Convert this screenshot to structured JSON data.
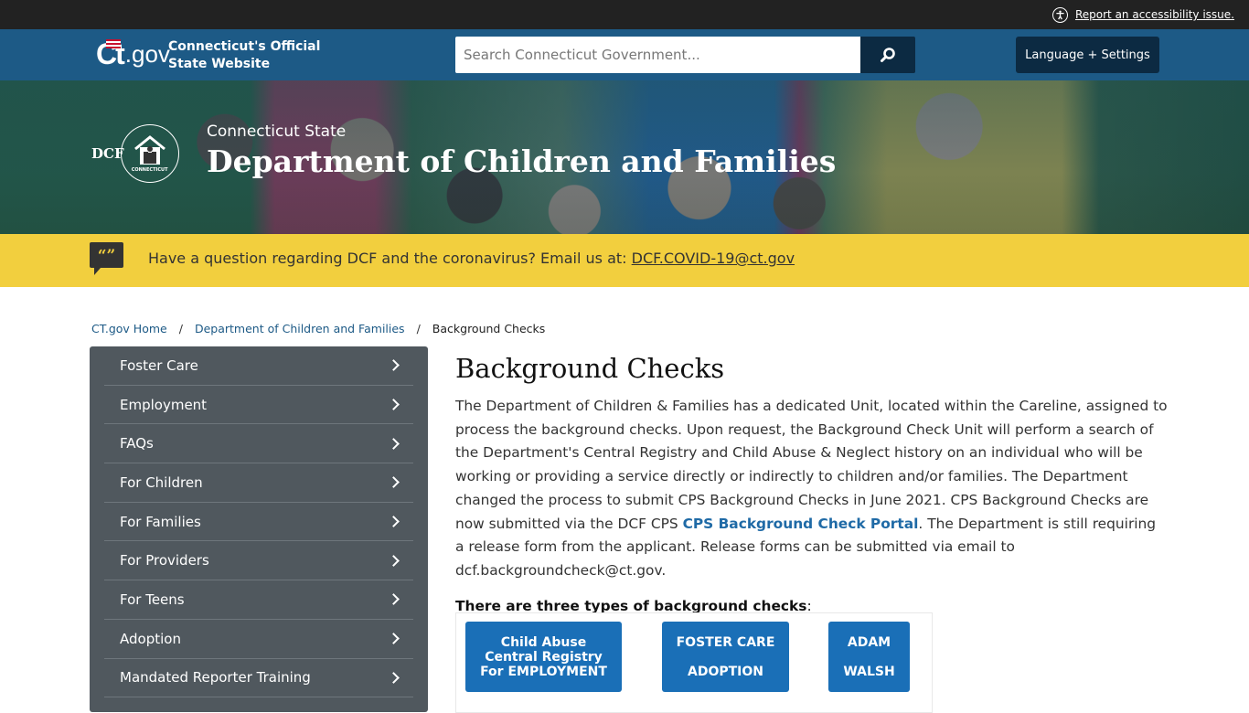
{
  "utility": {
    "accessibility_link": "Report an accessibility issue."
  },
  "header": {
    "logo_ct": "Ct",
    "logo_gov": ".gov",
    "site_name_line1": "Connecticut's Official",
    "site_name_line2": "State Website",
    "search_placeholder": "Search Connecticut Government...",
    "search_button_icon": "search-icon",
    "language_button": "Language + Settings"
  },
  "hero": {
    "logo_text": "DCF",
    "logo_small": "CONNECTICUT",
    "subtitle": "Connecticut State",
    "title": "Department of Children and Families"
  },
  "alert": {
    "icon": "quote-icon",
    "icon_glyph": "“”",
    "text": "Have a question regarding DCF and the coronavirus? Email us at: ",
    "email_link": "DCF.COVID-19@ct.gov"
  },
  "breadcrumb": {
    "items": [
      {
        "label": "CT.gov Home"
      },
      {
        "label": "Department of Children and Families"
      },
      {
        "label": "Background Checks"
      }
    ],
    "separator": "/"
  },
  "sidebar": {
    "items": [
      {
        "label": "Foster Care"
      },
      {
        "label": "Employment"
      },
      {
        "label": "FAQs"
      },
      {
        "label": "For Children"
      },
      {
        "label": "For Families"
      },
      {
        "label": "For Providers"
      },
      {
        "label": "For Teens"
      },
      {
        "label": "Adoption"
      },
      {
        "label": "Mandated Reporter Training"
      }
    ]
  },
  "main": {
    "title": "Background Checks",
    "paragraph_part1": "The Department of Children & Families has a dedicated Unit, located within the Careline, assigned to process the background checks. Upon request,  the Background Check Unit will perform a search of the Department's Central Registry and Child Abuse & Neglect history on an individual who will be working or providing a service directly or indirectly to children and/or families. The Department changed the process to submit CPS Background Checks in June 2021.  CPS Background Checks are now submitted via the DCF CPS ",
    "portal_link": "CPS Background Check Portal",
    "paragraph_part2": ".  The Department is still requiring a release form from the applicant.  Release forms can be submitted via email to dcf.backgroundcheck@ct.gov.",
    "lead_in_bold": "There are three types of background checks",
    "lead_in_colon": ":",
    "type_buttons": [
      {
        "line1": "Child Abuse",
        "line2": "Central Registry",
        "line3": "For EMPLOYMENT"
      },
      {
        "line1": "FOSTER CARE",
        "line2": "ADOPTION"
      },
      {
        "line1": "ADAM",
        "line2": "WALSH"
      }
    ]
  },
  "colors": {
    "utility_bar": "#222222",
    "header": "#1d5a86",
    "dark_button": "#0c2a42",
    "alert": "#f2cf3e",
    "sidebar": "#50585e",
    "link": "#1d5a86",
    "type_button": "#1a6fb7"
  }
}
